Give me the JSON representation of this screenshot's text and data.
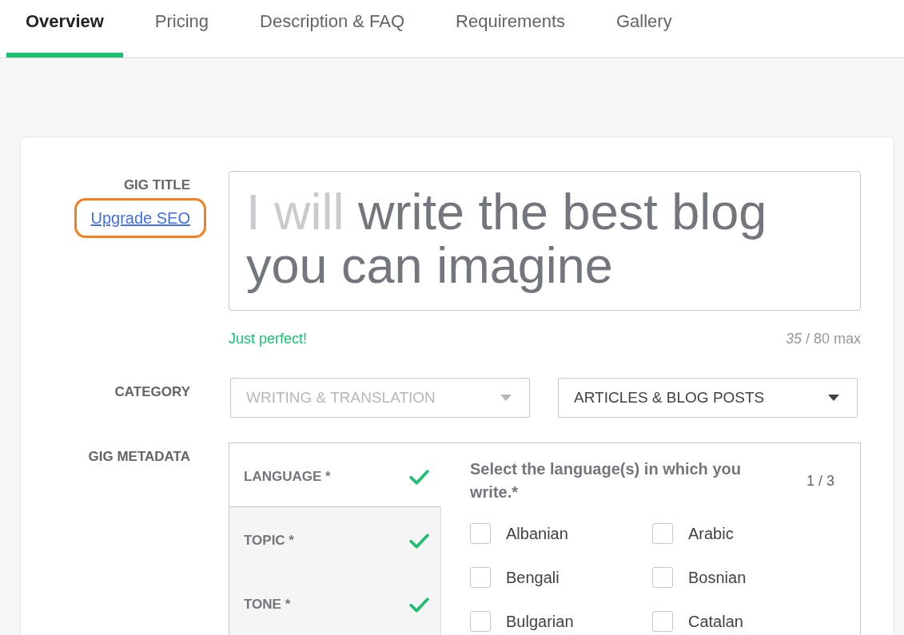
{
  "tabs": [
    {
      "label": "Overview",
      "selected": true
    },
    {
      "label": "Pricing",
      "selected": false
    },
    {
      "label": "Description & FAQ",
      "selected": false
    },
    {
      "label": "Requirements",
      "selected": false
    },
    {
      "label": "Gallery",
      "selected": false
    }
  ],
  "gig_title": {
    "label": "GIG TITLE",
    "seo_link": {
      "label": "Upgrade SEO",
      "highlighted": true
    },
    "prefix": "I will",
    "value": "write the best blog you can imagine",
    "hint": "Just perfect!",
    "counter": "*35* / 80 max"
  },
  "category": {
    "label": "CATEGORY",
    "selects": [
      {
        "value": "WRITING & TRANSLATION",
        "disabled": true
      },
      {
        "value": "ARTICLES & BLOG POSTS",
        "disabled": false
      }
    ]
  },
  "metadata": {
    "label": "GIG METADATA",
    "sections": [
      {
        "label": "LANGUAGE *",
        "selected": true,
        "done": true
      },
      {
        "label": "TOPIC *",
        "selected": false,
        "done": true
      },
      {
        "label": "TONE *",
        "selected": false,
        "done": true
      }
    ],
    "panel": {
      "heading": "Select the language(s) in which you write.*",
      "count": "1 / 3",
      "options": [
        {
          "label": "Albanian",
          "checked": false
        },
        {
          "label": "Arabic",
          "checked": false
        },
        {
          "label": "Bengali",
          "checked": false
        },
        {
          "label": "Bosnian",
          "checked": false
        },
        {
          "label": "Bulgarian",
          "checked": false
        },
        {
          "label": "Catalan",
          "checked": false
        }
      ]
    }
  }
}
